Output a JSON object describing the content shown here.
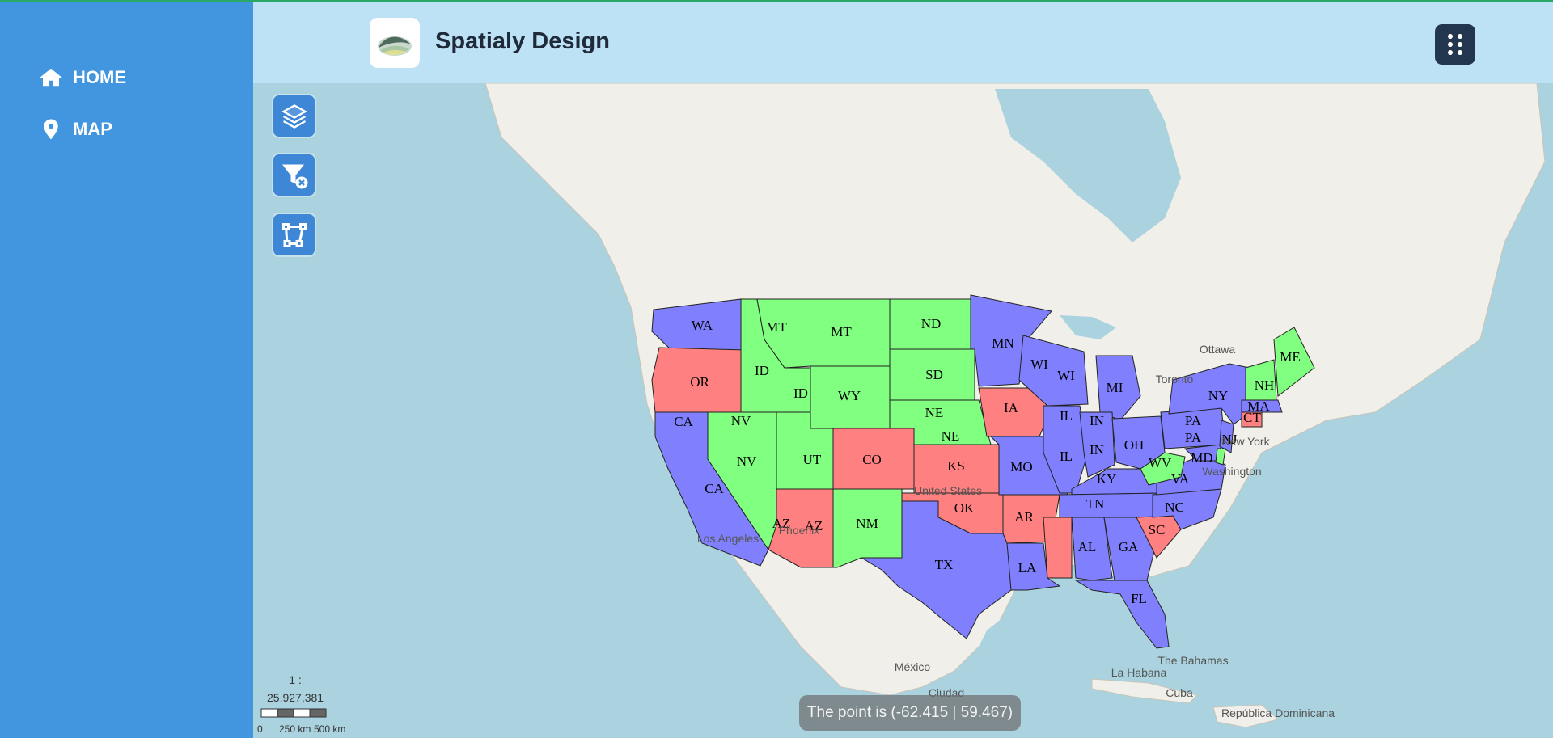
{
  "brand": {
    "name": "Spatialy Design"
  },
  "nav": [
    {
      "label": "HOME",
      "icon": "home-icon"
    },
    {
      "label": "MAP",
      "icon": "map-pin-icon"
    }
  ],
  "tools": [
    {
      "name": "layers-button",
      "icon": "layers-icon"
    },
    {
      "name": "clear-filter-button",
      "icon": "filter-clear-icon"
    },
    {
      "name": "draw-polygon-button",
      "icon": "polygon-draw-icon"
    }
  ],
  "header": {
    "menu_icon": "dots-grid-icon"
  },
  "scale": {
    "ratio": "1 : 25,927,381",
    "labels": [
      "0",
      "250 km",
      "500 km"
    ]
  },
  "status": {
    "pointer": "The point is (-62.415 | 59.467)"
  },
  "legend_colors": {
    "blue": "#8080ff",
    "green": "#80ff80",
    "red": "#ff8080"
  },
  "places": [
    "Ottawa",
    "Toronto",
    "New York",
    "Washington",
    "United States",
    "Los Angeles",
    "Phoenix",
    "México",
    "Ciudad",
    "The Bahamas",
    "La Habana",
    "Cuba",
    "República Dominicana"
  ],
  "states": [
    {
      "abbr": "WA",
      "color": "blue"
    },
    {
      "abbr": "OR",
      "color": "red"
    },
    {
      "abbr": "CA",
      "color": "blue"
    },
    {
      "abbr": "CA",
      "color": "blue"
    },
    {
      "abbr": "NV",
      "color": "green"
    },
    {
      "abbr": "NV",
      "color": "green"
    },
    {
      "abbr": "ID",
      "color": "green"
    },
    {
      "abbr": "ID",
      "color": "green"
    },
    {
      "abbr": "MT",
      "color": "green"
    },
    {
      "abbr": "MT",
      "color": "green"
    },
    {
      "abbr": "WY",
      "color": "green"
    },
    {
      "abbr": "UT",
      "color": "green"
    },
    {
      "abbr": "AZ",
      "color": "red"
    },
    {
      "abbr": "AZ",
      "color": "red"
    },
    {
      "abbr": "CO",
      "color": "red"
    },
    {
      "abbr": "NM",
      "color": "green"
    },
    {
      "abbr": "ND",
      "color": "green"
    },
    {
      "abbr": "SD",
      "color": "green"
    },
    {
      "abbr": "NE",
      "color": "green"
    },
    {
      "abbr": "NE",
      "color": "green"
    },
    {
      "abbr": "KS",
      "color": "red"
    },
    {
      "abbr": "OK",
      "color": "red"
    },
    {
      "abbr": "TX",
      "color": "blue"
    },
    {
      "abbr": "MN",
      "color": "blue"
    },
    {
      "abbr": "IA",
      "color": "red"
    },
    {
      "abbr": "MO",
      "color": "blue"
    },
    {
      "abbr": "AR",
      "color": "red"
    },
    {
      "abbr": "LA",
      "color": "blue"
    },
    {
      "abbr": "WI",
      "color": "blue"
    },
    {
      "abbr": "WI",
      "color": "blue"
    },
    {
      "abbr": "IL",
      "color": "blue"
    },
    {
      "abbr": "IL",
      "color": "blue"
    },
    {
      "abbr": "MI",
      "color": "blue"
    },
    {
      "abbr": "IN",
      "color": "blue"
    },
    {
      "abbr": "IN",
      "color": "blue"
    },
    {
      "abbr": "OH",
      "color": "blue"
    },
    {
      "abbr": "KY",
      "color": "blue"
    },
    {
      "abbr": "TN",
      "color": "blue"
    },
    {
      "abbr": "AL",
      "color": "blue"
    },
    {
      "abbr": "GA",
      "color": "blue"
    },
    {
      "abbr": "FL",
      "color": "blue"
    },
    {
      "abbr": "SC",
      "color": "red"
    },
    {
      "abbr": "NC",
      "color": "blue"
    },
    {
      "abbr": "VA",
      "color": "blue"
    },
    {
      "abbr": "WV",
      "color": "green"
    },
    {
      "abbr": "PA",
      "color": "blue"
    },
    {
      "abbr": "PA",
      "color": "blue"
    },
    {
      "abbr": "NY",
      "color": "blue"
    },
    {
      "abbr": "MD",
      "color": "blue"
    },
    {
      "abbr": "NJ",
      "color": "blue"
    },
    {
      "abbr": "CT",
      "color": "red"
    },
    {
      "abbr": "MA",
      "color": "blue"
    },
    {
      "abbr": "NH",
      "color": "green"
    },
    {
      "abbr": "ME",
      "color": "green"
    }
  ]
}
